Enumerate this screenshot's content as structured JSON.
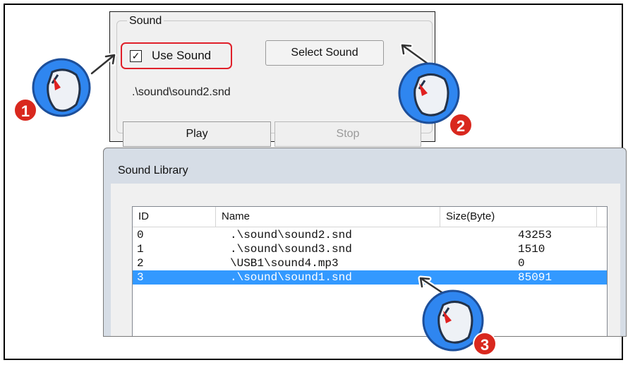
{
  "sound_panel": {
    "group_title": "Sound",
    "use_sound_checked": true,
    "use_sound_check_glyph": "✓",
    "use_sound_label": "Use Sound",
    "select_sound_label": "Select Sound",
    "current_path": ".\\sound\\sound2.snd",
    "play_label": "Play",
    "stop_label": "Stop"
  },
  "library": {
    "title": "Sound Library",
    "columns": [
      "ID",
      "Name",
      "Size(Byte)"
    ],
    "rows": [
      {
        "id": "0",
        "name": ".\\sound\\sound2.snd",
        "size": "43253",
        "selected": false
      },
      {
        "id": "1",
        "name": ".\\sound\\sound3.snd",
        "size": "1510",
        "selected": false
      },
      {
        "id": "2",
        "name": "\\USB1\\sound4.mp3",
        "size": "0",
        "selected": false
      },
      {
        "id": "3",
        "name": ".\\sound\\sound1.snd",
        "size": "85091",
        "selected": true
      }
    ]
  },
  "markers": [
    {
      "label": "1",
      "icon": "mouse-click-icon"
    },
    {
      "label": "2",
      "icon": "mouse-click-icon"
    },
    {
      "label": "3",
      "icon": "mouse-click-icon"
    }
  ],
  "colors": {
    "accent_red": "#d9281e",
    "highlight_border": "#e0202a",
    "selection_blue": "#3399ff",
    "marker_blue": "#2f86f0"
  }
}
